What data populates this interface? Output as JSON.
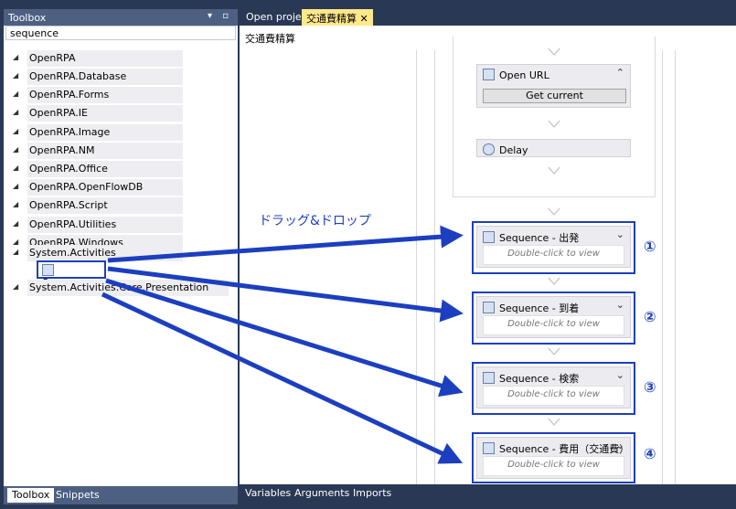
{
  "toolbox": {
    "title": "Toolbox",
    "search_value": "sequence",
    "categories": [
      "OpenRPA",
      "OpenRPA.Database",
      "OpenRPA.Forms",
      "OpenRPA.IE",
      "OpenRPA.Image",
      "OpenRPA.NM",
      "OpenRPA.Office",
      "OpenRPA.OpenFlowDB",
      "OpenRPA.Script",
      "OpenRPA.Utilities",
      "OpenRPA.Windows",
      "System.Activities",
      "System.Activities.Core.Presentation"
    ],
    "sequence_item": "Sequence",
    "tabs": [
      "Toolbox",
      "Snippets"
    ]
  },
  "document": {
    "tabs": [
      "Open project",
      "交通費精算"
    ],
    "breadcrumb": "交通費精算",
    "open_url_label": "Open URL",
    "get_current_label": "Get current",
    "delay_label": "Delay",
    "sequences": [
      {
        "title": "Sequence - 出発",
        "hint": "Double-click to view",
        "number": "①"
      },
      {
        "title": "Sequence - 到着",
        "hint": "Double-click to view",
        "number": "②"
      },
      {
        "title": "Sequence - 検索",
        "hint": "Double-click to view",
        "number": "③"
      },
      {
        "title": "Sequence - 費用（交通費）",
        "hint": "Double-click to view",
        "number": "④"
      }
    ],
    "bottom_tabs": [
      "Variables",
      "Arguments",
      "Imports"
    ]
  },
  "annotation": {
    "drag_label": "ドラッグ&ドロップ",
    "color": "#1c3fbf"
  }
}
